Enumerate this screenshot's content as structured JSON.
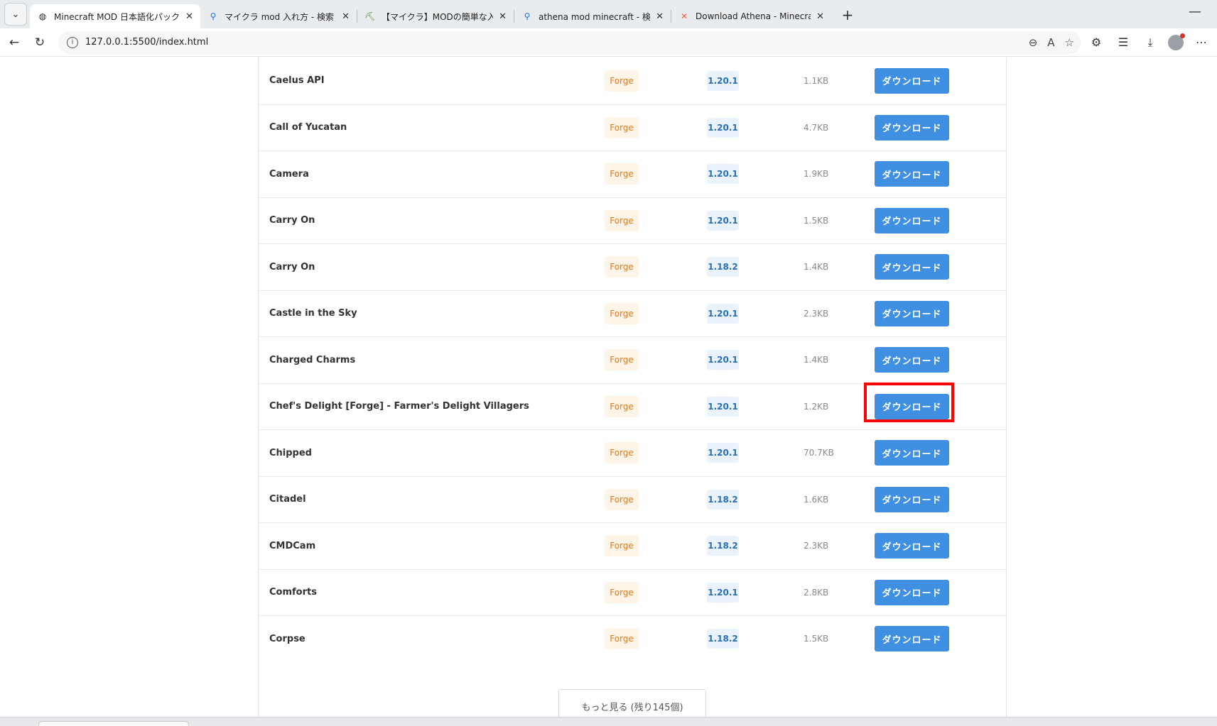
{
  "browser": {
    "tabs": [
      {
        "title": "Minecraft MOD 日本語化パック配布",
        "icon": "globe-icon",
        "active": true
      },
      {
        "title": "マイクラ mod 入れ方 - 検索",
        "icon": "search-icon",
        "active": false
      },
      {
        "title": "【マイクラ】MODの簡単な入れ方！影",
        "icon": "pickaxe-icon",
        "active": false
      },
      {
        "title": "athena mod minecraft - 検索",
        "icon": "search-icon",
        "active": false
      },
      {
        "title": "Download Athena - Minecraft Mod",
        "icon": "curseforge-icon",
        "active": false
      }
    ],
    "url": "127.0.0.1:5500/index.html"
  },
  "mods": [
    {
      "name": "Caelus API",
      "loader": "Forge",
      "version": "1.20.1",
      "size": "1.1KB",
      "download_label": "ダウンロード"
    },
    {
      "name": "Call of Yucatan",
      "loader": "Forge",
      "version": "1.20.1",
      "size": "4.7KB",
      "download_label": "ダウンロード"
    },
    {
      "name": "Camera",
      "loader": "Forge",
      "version": "1.20.1",
      "size": "1.9KB",
      "download_label": "ダウンロード"
    },
    {
      "name": "Carry On",
      "loader": "Forge",
      "version": "1.20.1",
      "size": "1.5KB",
      "download_label": "ダウンロード"
    },
    {
      "name": "Carry On",
      "loader": "Forge",
      "version": "1.18.2",
      "size": "1.4KB",
      "download_label": "ダウンロード"
    },
    {
      "name": "Castle in the Sky",
      "loader": "Forge",
      "version": "1.20.1",
      "size": "2.3KB",
      "download_label": "ダウンロード"
    },
    {
      "name": "Charged Charms",
      "loader": "Forge",
      "version": "1.20.1",
      "size": "1.4KB",
      "download_label": "ダウンロード"
    },
    {
      "name": "Chef's Delight [Forge] - Farmer's Delight Villagers",
      "loader": "Forge",
      "version": "1.20.1",
      "size": "1.2KB",
      "download_label": "ダウンロード"
    },
    {
      "name": "Chipped",
      "loader": "Forge",
      "version": "1.20.1",
      "size": "70.7KB",
      "download_label": "ダウンロード"
    },
    {
      "name": "Citadel",
      "loader": "Forge",
      "version": "1.18.2",
      "size": "1.6KB",
      "download_label": "ダウンロード"
    },
    {
      "name": "CMDCam",
      "loader": "Forge",
      "version": "1.18.2",
      "size": "2.3KB",
      "download_label": "ダウンロード"
    },
    {
      "name": "Comforts",
      "loader": "Forge",
      "version": "1.20.1",
      "size": "2.8KB",
      "download_label": "ダウンロード"
    },
    {
      "name": "Corpse",
      "loader": "Forge",
      "version": "1.18.2",
      "size": "1.5KB",
      "download_label": "ダウンロード"
    }
  ],
  "load_more_label": "もっと見る (残り145個)",
  "colors": {
    "download_button": "#3f8fe2",
    "loader_badge_bg": "#fff4e8",
    "loader_badge_text": "#e07a1f",
    "version_badge_bg": "#eaf3fc",
    "version_badge_text": "#2a6fb5",
    "highlight": "#ff0000"
  }
}
